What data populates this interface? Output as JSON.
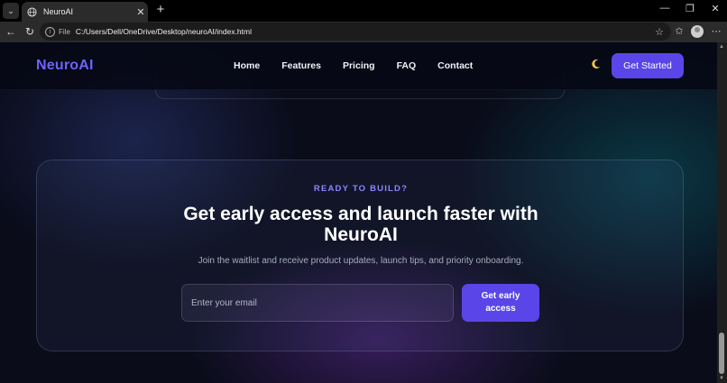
{
  "browser": {
    "tab_title": "NeuroAI",
    "scheme_label": "File",
    "url": "C:/Users/Dell/OneDrive/Desktop/neuroAI/index.html"
  },
  "site": {
    "logo": "NeuroAI",
    "nav": [
      {
        "label": "Home"
      },
      {
        "label": "Features"
      },
      {
        "label": "Pricing"
      },
      {
        "label": "FAQ"
      },
      {
        "label": "Contact"
      }
    ],
    "theme_toggle_icon": "moon-icon",
    "cta_label": "Get Started"
  },
  "cta_section": {
    "eyebrow": "READY TO BUILD?",
    "headline": "Get early access and launch faster with NeuroAI",
    "subtext": "Join the waitlist and receive product updates, launch tips, and priority onboarding.",
    "email_placeholder": "Enter your email",
    "email_value": "",
    "submit_label": "Get early access"
  },
  "colors": {
    "accent": "#5a46e8",
    "logo": "#6c63ff",
    "eyebrow": "#8d86ff",
    "background": "#0a0c1a"
  }
}
